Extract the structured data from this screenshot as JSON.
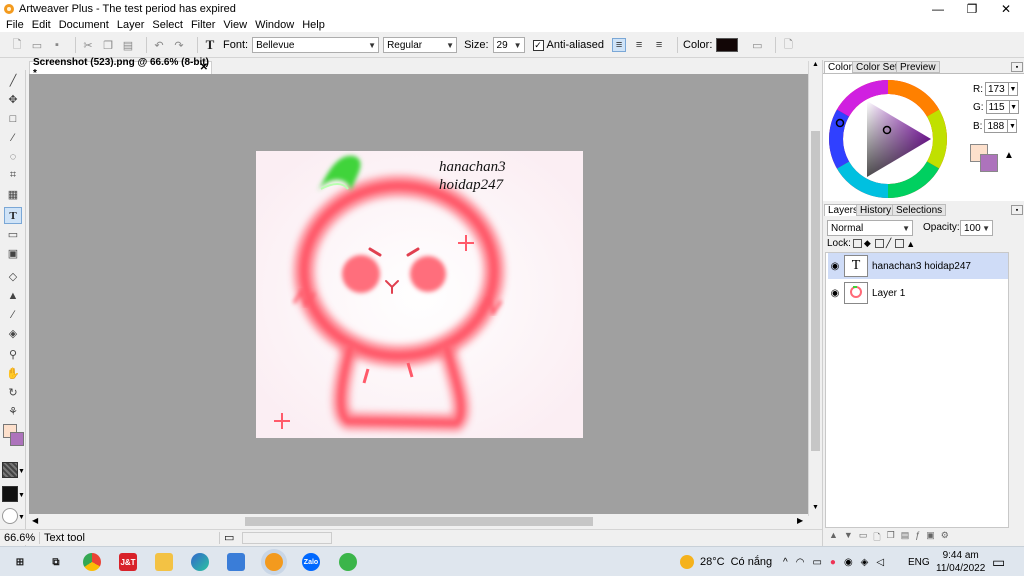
{
  "app": {
    "title": "Artweaver Plus - The test period has expired",
    "window_controls": {
      "minimize": "—",
      "maximize": "❐",
      "close": "✕"
    }
  },
  "menu": [
    "File",
    "Edit",
    "Document",
    "Layer",
    "Select",
    "Filter",
    "View",
    "Window",
    "Help"
  ],
  "toolbar": {
    "font_label": "Font:",
    "font_value": "Bellevue",
    "style_value": "Regular",
    "size_label": "Size:",
    "size_value": "29",
    "antialiased_label": "Anti-aliased",
    "antialiased_checked": true,
    "color_label": "Color:",
    "text_color": "#120606"
  },
  "document": {
    "tab_title": "Screenshot (523).png @ 66.6% (8-bit) *",
    "close_glyph": "✕",
    "canvas_text_line1": "hanachan3",
    "canvas_text_line2": "hoidap247"
  },
  "status": {
    "zoom": "66.6%",
    "tool_name": "Text tool"
  },
  "color_panel": {
    "tabs": [
      "Color",
      "Color Set",
      "Preview"
    ],
    "r_label": "R:",
    "r": "173",
    "g_label": "G:",
    "g": "115",
    "b_label": "B:",
    "b": "188",
    "foreground": "#fde0cc",
    "background": "#ad73bc"
  },
  "layers_panel": {
    "tabs": [
      "Layers",
      "History",
      "Selections"
    ],
    "blend_mode": "Normal",
    "opacity_label": "Opacity:",
    "opacity": "100",
    "lock_label": "Lock:",
    "layers": [
      {
        "name": "hanachan3 hoidap247",
        "selected": true
      },
      {
        "name": "Layer 1",
        "selected": false
      }
    ]
  },
  "taskbar": {
    "weather_temp": "28°C",
    "weather_desc": "Có nắng",
    "lang": "ENG",
    "time": "9:44 am",
    "date": "11/04/2022",
    "jt_label": "J&T",
    "zalo_label": "Zalo"
  }
}
